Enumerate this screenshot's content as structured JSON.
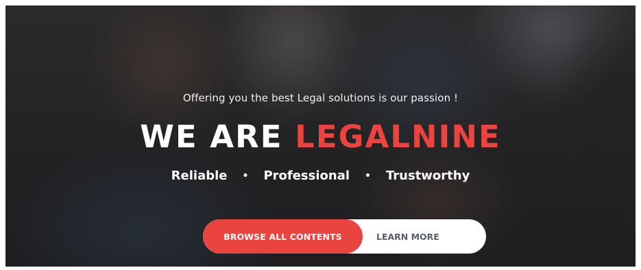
{
  "hero": {
    "tagline": "Offering you the best Legal solutions is our passion !",
    "headline_prefix": "WE ARE",
    "headline_accent": "LEGALNINE",
    "qualities": [
      "Reliable",
      "Professional",
      "Trustworthy"
    ],
    "separator": "•"
  },
  "cta": {
    "browse_label": "BROWSE ALL CONTENTS",
    "learn_label": "LEARN MORE"
  },
  "colors": {
    "accent": "#ea4440",
    "text_light": "#ffffff",
    "learn_text": "#555d6b"
  }
}
